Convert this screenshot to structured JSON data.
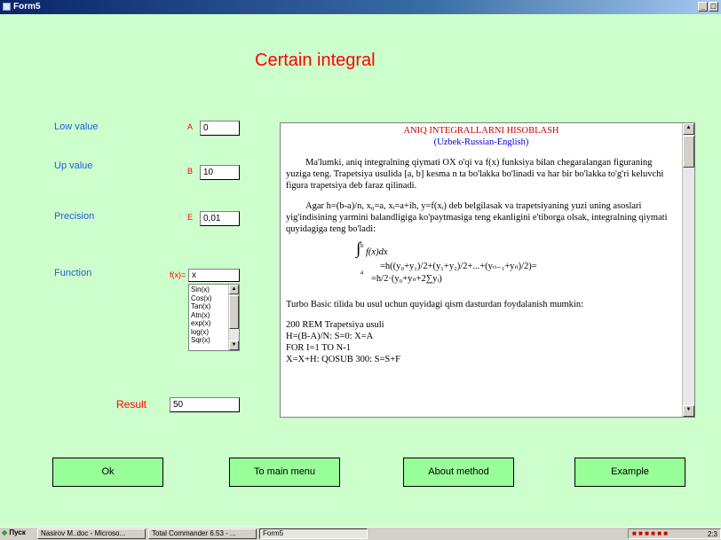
{
  "window": {
    "title": "Form5",
    "min_label": "_",
    "max_label": "□"
  },
  "page": {
    "heading": "Certain integral"
  },
  "form": {
    "low": {
      "label": "Low value",
      "letter": "A",
      "value": "0"
    },
    "up": {
      "label": "Up value",
      "letter": "B",
      "value": "10"
    },
    "precision": {
      "label": "Precision",
      "letter": "E",
      "value": "0,01"
    },
    "function": {
      "label": "Function",
      "prefix": "f(x)=",
      "value": "x",
      "options": [
        "Sin(x)",
        "Cos(x)",
        "Tan(x)",
        "Atn(x)",
        "exp(x)",
        "log(x)",
        "Sqr(x)"
      ]
    },
    "result": {
      "label": "Result",
      "value": "50"
    }
  },
  "text": {
    "title": "ANIQ INTEGRALLARNI HISOBLASH",
    "subtitle": "(Uzbek-Russian-English)",
    "p1": "Ma'lumki, aniq integralning qiymati OX o'qi va f(x) funksiya bilan chegaralangan figuraning yuziga teng. Trapetsiya usulida [a, b] kesma n ta bo'lakka bo'linadi va har bir bo'lakka to'g'ri keluvchi figura trapetsiya deb faraz qilinadi.",
    "p2": "Agar h=(b-a)/n, x₀=a, xᵢ=a+ih, y=f(xᵢ) deb belgilasak va trapetsiyaning yuzi uning asoslari yig'indisining yarmini balandligiga ko'paytmasiga teng ekanligini e'tiborga olsak, integralning qiymati quyidagiga teng bo'ladi:",
    "formula_upper": "b",
    "formula_lower": "a",
    "formula_integral": "∫",
    "formula_integrand": "f(x)dx",
    "formula_line1": "=h((y₀+y₁)/2+(y₁+y₂)/2+...+(yₙ₋₁+yₙ)/2)=",
    "formula_line2": "=h/2·(y₀+yₙ+2∑yᵢ)",
    "p3": "Turbo Basic tilida bu usul uchun quyidagi qism dasturdan foydalanish mumkin:",
    "code": [
      "200 REM  Trapetsiya usuli",
      "H=(B-A)/N: S=0: X=A",
      "FOR I=1 TO N-1",
      "X=X+H: QOSUB 300: S=S+F"
    ]
  },
  "buttons": {
    "ok": "Ok",
    "main_menu": "To main menu",
    "about": "About method",
    "example": "Example"
  },
  "taskbar": {
    "start": "Пуск",
    "tasks": [
      "Nasirov M..doc - Microso...",
      "Total Commander 6.53 - ...",
      "Form5"
    ],
    "clock": "2:3"
  },
  "colors": {
    "background": "#ccffcc",
    "button": "#99ff99",
    "label": "#1f5fd6",
    "accent": "#ff0000"
  }
}
